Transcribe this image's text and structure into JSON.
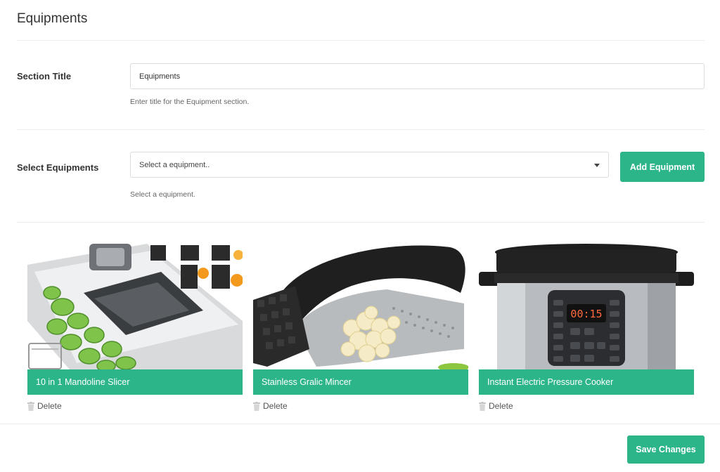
{
  "page": {
    "title": "Equipments"
  },
  "section_title": {
    "label": "Section Title",
    "value": "Equipments",
    "help": "Enter title for the Equipment section."
  },
  "select_equipments": {
    "label": "Select Equipments",
    "placeholder": "Select a equipment..",
    "help": "Select a equipment.",
    "button_label": "Add Equipment"
  },
  "equipments": [
    {
      "name": "10 in 1 Mandoline Slicer",
      "delete_label": "Delete",
      "icon": "mandoline-slicer-image"
    },
    {
      "name": "Stainless Gralic Mincer",
      "delete_label": "Delete",
      "icon": "garlic-mincer-image"
    },
    {
      "name": "Instant Electric Pressure Cooker",
      "delete_label": "Delete",
      "icon": "pressure-cooker-image"
    }
  ],
  "footer": {
    "save_label": "Save Changes"
  },
  "colors": {
    "accent": "#2db58a",
    "divider": "#ececec",
    "border": "#dcdcdc"
  }
}
